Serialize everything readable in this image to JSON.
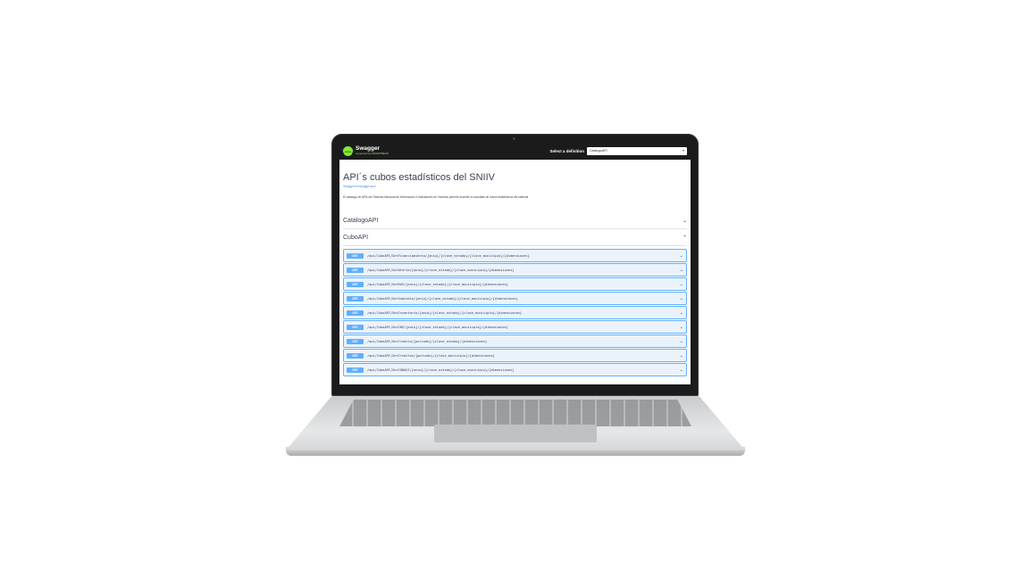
{
  "swagger": {
    "logo_mark": "{…}",
    "logo_title": "Swagger",
    "logo_sub": "supported by SMARTBEAR",
    "select_label": "Select a definition",
    "select_value": "CatalogoAPI",
    "select_chevron": "▾"
  },
  "info": {
    "title": "API´s cubos estadísticos del SNIIV",
    "subtitle": "/swagger/v1/swagger.json",
    "description": "El catálogo de APIs del Sistema Nacional de Información e Indicadores de Vivienda permite acceder a consultas de cubos estadísticos del sistema"
  },
  "tags": [
    {
      "name": "CatalogoAPI",
      "chevron": "⌄"
    },
    {
      "name": "CuboAPI",
      "chevron": "⌃"
    }
  ],
  "operations": [
    {
      "method": "GET",
      "path": "/api/CuboAPI/GetFinanciamiento/{anio}/{clave_estado}/{clave_municipio}/{dimensiones}",
      "chevron": "⌄"
    },
    {
      "method": "GET",
      "path": "/api/CuboAPI/GetOferta/{anio}/{clave_estado}/{clave_municipio}/{dimensiones}",
      "chevron": "⌄"
    },
    {
      "method": "GET",
      "path": "/api/CuboAPI/GetRUV/{anio}/{clave_estado}/{clave_municipio}/{dimensiones}",
      "chevron": "⌄"
    },
    {
      "method": "GET",
      "path": "/api/CuboAPI/GetSubsidio/{anio}/{clave_estado}/{clave_municipio}/{dimensiones}",
      "chevron": "⌄"
    },
    {
      "method": "GET",
      "path": "/api/CuboAPI/GetInventario/{anio}/{clave_estado}/{clave_municipio}/{dimensiones}",
      "chevron": "⌄"
    },
    {
      "method": "GET",
      "path": "/api/CuboAPI/GetINV/{anio}/{clave_estado}/{clave_municipio}/{dimensiones}",
      "chevron": "⌄"
    },
    {
      "method": "GET",
      "path": "/api/CuboAPI/GetCredito/{periodo}/{clave_estado}/{dimensiones}",
      "chevron": "⌄"
    },
    {
      "method": "GET",
      "path": "/api/CuboAPI/GetCreditos/{periodo}/{clave_municipio}/{dimensiones}",
      "chevron": "⌄"
    },
    {
      "method": "GET",
      "path": "/api/CuboAPI/GetCONAVI/{anio}/{clave_estado}/{clave_municipio}/{dimensiones}",
      "chevron": "⌄"
    }
  ]
}
